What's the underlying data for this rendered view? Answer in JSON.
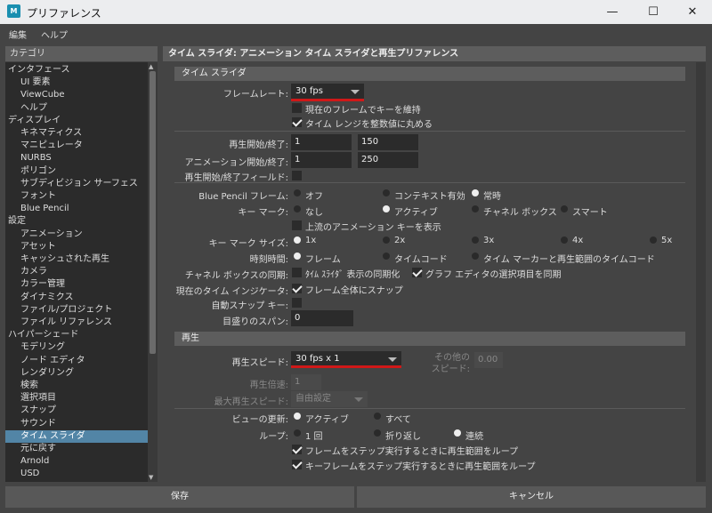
{
  "window": {
    "app_icon_text": "M",
    "title": "プリファレンス",
    "minimize_symbol": "—",
    "maximize_symbol": "☐",
    "close_symbol": "✕"
  },
  "menu": [
    "編集",
    "ヘルプ"
  ],
  "categories": {
    "header": "カテゴリ",
    "items": [
      {
        "label": "インタフェース",
        "indent": 0
      },
      {
        "label": "UI 要素",
        "indent": 1
      },
      {
        "label": "ViewCube",
        "indent": 1
      },
      {
        "label": "ヘルプ",
        "indent": 1
      },
      {
        "label": "ディスプレイ",
        "indent": 0
      },
      {
        "label": "キネマティクス",
        "indent": 1
      },
      {
        "label": "マニピュレータ",
        "indent": 1
      },
      {
        "label": "NURBS",
        "indent": 1
      },
      {
        "label": "ポリゴン",
        "indent": 1
      },
      {
        "label": "サブディビジョン サーフェス",
        "indent": 1
      },
      {
        "label": "フォント",
        "indent": 1
      },
      {
        "label": "Blue Pencil",
        "indent": 1
      },
      {
        "label": "設定",
        "indent": 0
      },
      {
        "label": "アニメーション",
        "indent": 1
      },
      {
        "label": "アセット",
        "indent": 1
      },
      {
        "label": "キャッシュされた再生",
        "indent": 1
      },
      {
        "label": "カメラ",
        "indent": 1
      },
      {
        "label": "カラー管理",
        "indent": 1
      },
      {
        "label": "ダイナミクス",
        "indent": 1
      },
      {
        "label": "ファイル/プロジェクト",
        "indent": 1
      },
      {
        "label": "ファイル リファレンス",
        "indent": 1
      },
      {
        "label": "ハイパーシェード",
        "indent": 0
      },
      {
        "label": "モデリング",
        "indent": 1
      },
      {
        "label": "ノード エディタ",
        "indent": 1
      },
      {
        "label": "レンダリング",
        "indent": 1
      },
      {
        "label": "検索",
        "indent": 1
      },
      {
        "label": "選択項目",
        "indent": 1
      },
      {
        "label": "スナップ",
        "indent": 1
      },
      {
        "label": "サウンド",
        "indent": 1
      },
      {
        "label": "タイム スライダ",
        "indent": 1,
        "selected": true
      },
      {
        "label": "元に戻す",
        "indent": 1
      },
      {
        "label": "Arnold",
        "indent": 1
      },
      {
        "label": "USD",
        "indent": 1
      }
    ]
  },
  "main": {
    "header": "タイム スライダ: アニメーション タイム スライダと再生プリファレンス"
  },
  "timeslider": {
    "section": "タイム スライダ",
    "framerate_label": "フレームレート:",
    "framerate_value": "30 fps",
    "keep_key_label": "現在のフレームでキーを維持",
    "round_label": "タイム レンジを整数値に丸める",
    "playback_range_label": "再生開始/終了:",
    "playback_start": "1",
    "playback_end": "150",
    "anim_range_label": "アニメーション開始/終了:",
    "anim_start": "1",
    "anim_end": "250",
    "range_fields_label": "再生開始/終了フィールド:",
    "bp_label": "Blue Pencil フレーム:",
    "bp_opts": [
      "オフ",
      "コンテキスト有効",
      "常時"
    ],
    "key_mark_label": "キー マーク:",
    "key_mark_opts": [
      "なし",
      "アクティブ",
      "チャネル ボックス",
      "スマート"
    ],
    "upstream_label": "上流のアニメーション キーを表示",
    "key_size_label": "キー マーク サイズ:",
    "key_size_opts": [
      "1x",
      "2x",
      "3x",
      "4x",
      "5x"
    ],
    "time_label": "時刻時間:",
    "time_opts": [
      "フレーム",
      "タイムコード",
      "タイム マーカーと再生範囲のタイムコード"
    ],
    "cb_sync_label": "チャネル ボックスの同期:",
    "cb_sync_opt": "ﾀｲﾑ ｽﾗｲﾀﾞ 表示の同期化",
    "graph_sync_opt": "グラフ エディタの選択項目を同期",
    "indicator_label": "現在のタイム インジケータ:",
    "indicator_opt": "フレーム全体にスナップ",
    "autosnap_label": "自動スナップ キー:",
    "tick_label": "目盛りのスパン:",
    "tick_value": "0"
  },
  "playback": {
    "section": "再生",
    "speed_label": "再生スピード:",
    "speed_value": "30 fps x 1",
    "other_speed_label_1": "その他の",
    "other_speed_label_2": "スピード:",
    "other_speed_value": "0.00",
    "multiplier_label": "再生倍速:",
    "multiplier_value": "1",
    "max_label": "最大再生スピード:",
    "max_value": "自由設定",
    "update_label": "ビューの更新:",
    "update_opts": [
      "アクティブ",
      "すべて"
    ],
    "loop_label": "ループ:",
    "loop_opts": [
      "1 回",
      "折り返し",
      "連続"
    ],
    "step_frame_label": "フレームをステップ実行するときに再生範囲をループ",
    "step_key_label": "キーフレームをステップ実行するときに再生範囲をループ"
  },
  "buttons": {
    "save": "保存",
    "cancel": "キャンセル"
  },
  "accent_red": "#d01818",
  "selection_blue": "#5285a6"
}
